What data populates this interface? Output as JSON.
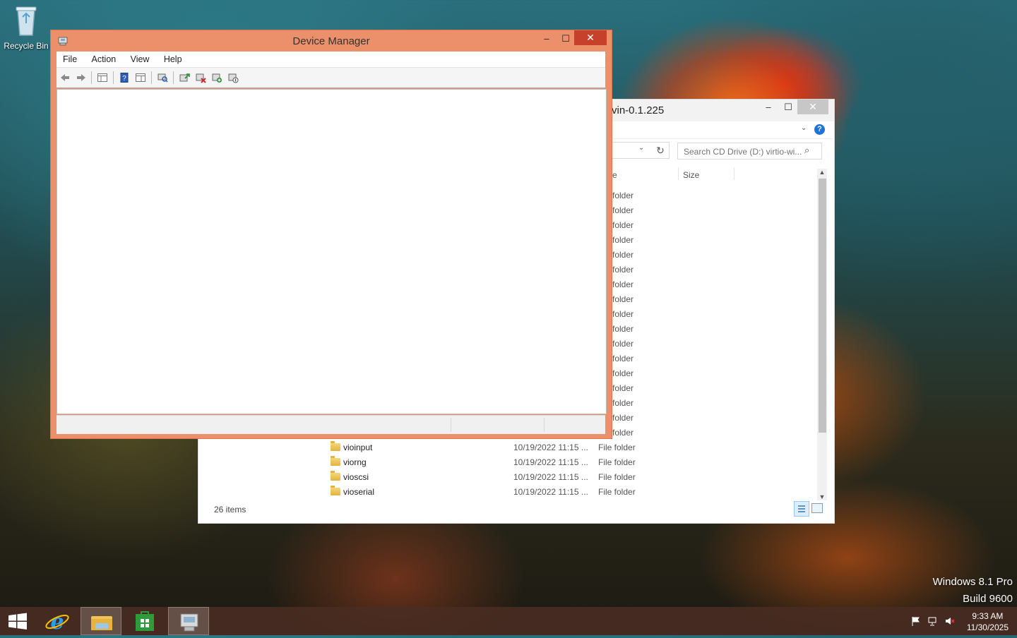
{
  "desktop": {
    "recycle_bin_label": "Recycle Bin",
    "edition": "Windows 8.1 Pro",
    "build": "Build 9600"
  },
  "explorer": {
    "title_partial": "vin-0.1.225",
    "search_placeholder": "Search CD Drive (D:) virtio-wi...",
    "column_type_partial": "e",
    "column_size": "Size",
    "hidden_rows_type": [
      "folder",
      "folder",
      "folder",
      "folder",
      "folder",
      "folder",
      "folder",
      "folder",
      "folder",
      "folder",
      "folder",
      "folder",
      "folder",
      "folder",
      "folder",
      "folder",
      "folder"
    ],
    "rows": [
      {
        "name": "vioinput",
        "date": "10/19/2022 11:15 ...",
        "type": "File folder"
      },
      {
        "name": "viorng",
        "date": "10/19/2022 11:15 ...",
        "type": "File folder"
      },
      {
        "name": "vioscsi",
        "date": "10/19/2022 11:15 ...",
        "type": "File folder"
      },
      {
        "name": "vioserial",
        "date": "10/19/2022 11:15 ...",
        "type": "File folder"
      }
    ],
    "status": "26 items",
    "minimize": "–",
    "maximize": "☐",
    "close": "✕",
    "help": "?",
    "refresh": "↻",
    "chevron": "⌄",
    "search_icon": "⌕"
  },
  "device_manager": {
    "title": "Device Manager",
    "menu": [
      "File",
      "Action",
      "View",
      "Help"
    ],
    "minimize": "–",
    "maximize": "☐",
    "close": "✕"
  },
  "taskbar": {
    "time": "9:33 AM",
    "date": "11/30/2025"
  },
  "colors": {
    "dm_frame": "#ec8f6b",
    "dm_close": "#c7402b",
    "taskbar": "#4a2c22",
    "help_blue": "#1e73d6"
  }
}
